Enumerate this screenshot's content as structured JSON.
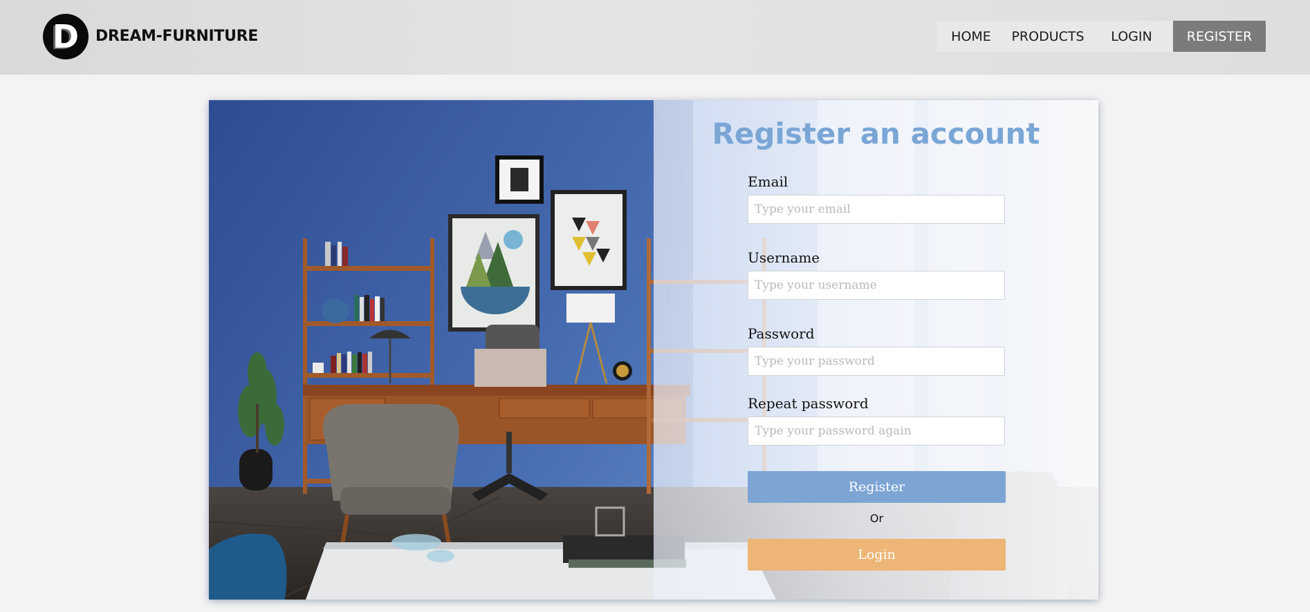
{
  "header": {
    "logo_letter": "D",
    "brand": "DREAM-FURNITURE",
    "nav": {
      "home": "HOME",
      "products": "PRODUCTS",
      "login": "LOGIN",
      "register": "REGISTER"
    },
    "active_nav": "REGISTER"
  },
  "form": {
    "title": "Register an account",
    "email": {
      "label": "Email",
      "placeholder": "Type your email",
      "value": ""
    },
    "username": {
      "label": "Username",
      "placeholder": "Type your username",
      "value": ""
    },
    "password": {
      "label": "Password",
      "placeholder": "Type your password",
      "value": ""
    },
    "repeat_password": {
      "label": "Repeat password",
      "placeholder": "Type your password again",
      "value": ""
    },
    "register_button": "Register",
    "or_text": "Or",
    "login_button": "Login"
  },
  "colors": {
    "title_blue": "#7aa6d6",
    "register_button": "#7ca5d4",
    "login_button": "#edb677",
    "active_nav_bg": "#7b7b7b"
  }
}
